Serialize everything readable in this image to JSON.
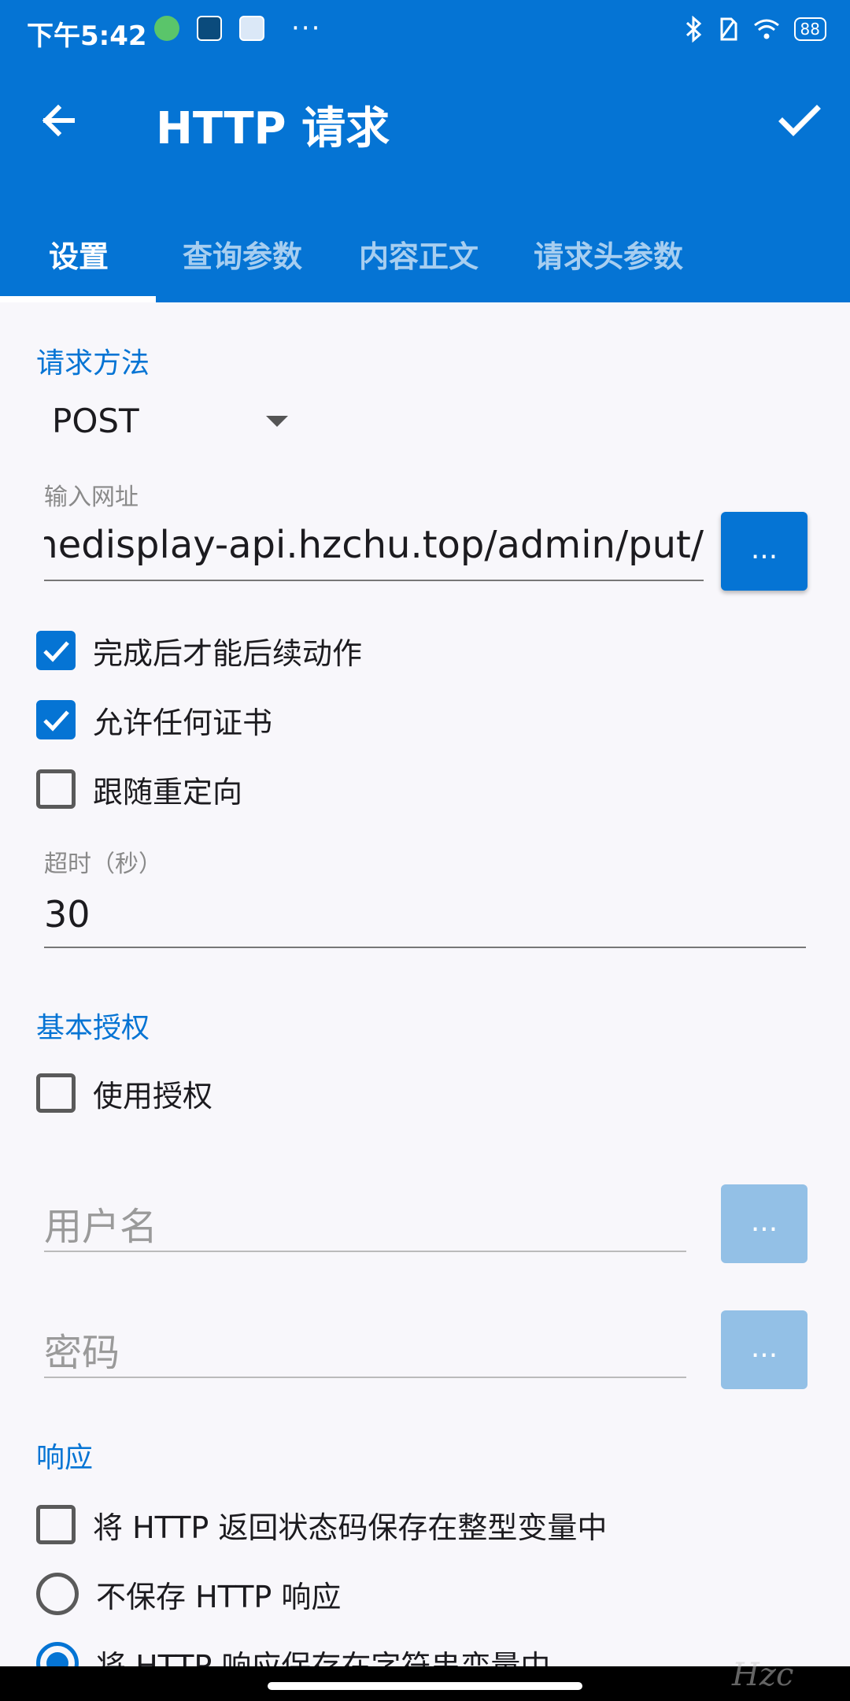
{
  "status_bar": {
    "time": "下午5:42",
    "dots": "···",
    "battery": "88"
  },
  "toolbar": {
    "title": "HTTP 请求"
  },
  "tabs": [
    {
      "label": "设置"
    },
    {
      "label": "查询参数"
    },
    {
      "label": "内容正文"
    },
    {
      "label": "请求头参数"
    }
  ],
  "request_method": {
    "section_title": "请求方法",
    "value": "POST"
  },
  "url": {
    "label": "输入网址",
    "value": "nedisplay-api.hzchu.top/admin/put/",
    "button_label": "..."
  },
  "options": [
    {
      "label": "完成后才能后续动作",
      "checked": true
    },
    {
      "label": "允许任何证书",
      "checked": true
    },
    {
      "label": "跟随重定向",
      "checked": false
    }
  ],
  "timeout": {
    "label": "超时（秒）",
    "value": "30"
  },
  "auth": {
    "section_title": "基本授权",
    "use_auth_label": "使用授权",
    "use_auth_checked": false,
    "username_placeholder": "用户名",
    "password_placeholder": "密码",
    "button_label": "..."
  },
  "response": {
    "section_title": "响应",
    "save_status_label": "将 HTTP 返回状态码保存在整型变量中",
    "save_status_checked": false,
    "radio_options": [
      {
        "label": "不保存 HTTP 响应",
        "selected": false
      },
      {
        "label": "将 HTTP 响应保存在字符串变量中",
        "selected": true
      }
    ]
  },
  "watermark": "Hzc",
  "colors": {
    "primary": "#0574d4",
    "primary_disabled": "#93c0e6",
    "background": "#f8f7fb"
  }
}
